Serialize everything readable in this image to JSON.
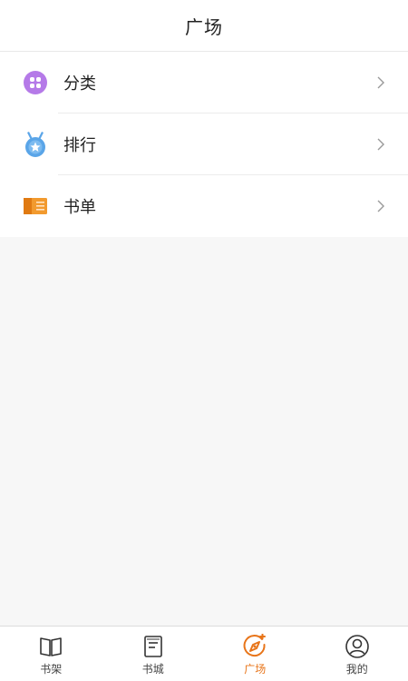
{
  "header": {
    "title": "广场"
  },
  "menu": {
    "items": [
      {
        "label": "分类",
        "icon": "category-icon"
      },
      {
        "label": "排行",
        "icon": "ranking-medal-icon"
      },
      {
        "label": "书单",
        "icon": "booklist-icon"
      }
    ]
  },
  "tabbar": {
    "items": [
      {
        "label": "书架",
        "icon": "bookshelf-icon",
        "active": false
      },
      {
        "label": "书城",
        "icon": "bookstore-icon",
        "active": false
      },
      {
        "label": "广场",
        "icon": "plaza-icon",
        "active": true
      },
      {
        "label": "我的",
        "icon": "profile-icon",
        "active": false
      }
    ]
  },
  "colors": {
    "accent": "#e8751a",
    "category_icon": "#b57ae8",
    "ranking_icon": "#5aa5e8",
    "booklist_icon": "#f29a2e"
  }
}
